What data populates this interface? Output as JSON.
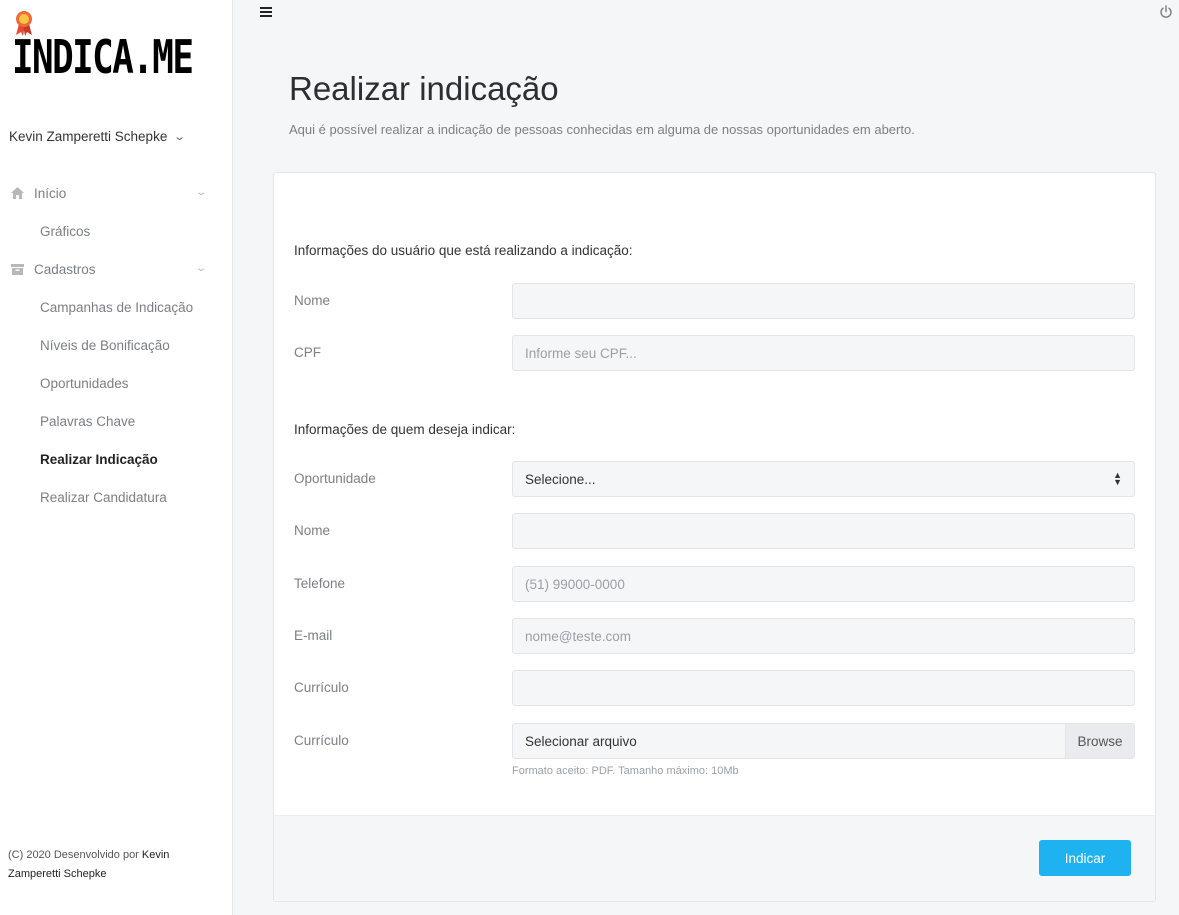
{
  "brand": {
    "logo_text": "INDICA.ME",
    "badge_color": "#f26a3b"
  },
  "user": {
    "name": "Kevin Zamperetti Schepke"
  },
  "sidebar": {
    "items": [
      {
        "label": "Início",
        "icon": "home-icon",
        "group": true
      },
      {
        "label": "Gráficos",
        "group": false
      },
      {
        "label": "Cadastros",
        "icon": "archive-icon",
        "group": true
      },
      {
        "label": "Campanhas de Indicação",
        "group": false
      },
      {
        "label": "Níveis de Bonificação",
        "group": false
      },
      {
        "label": "Oportunidades",
        "group": false
      },
      {
        "label": "Palavras Chave",
        "group": false
      },
      {
        "label": "Realizar Indicação",
        "group": false,
        "active": true
      },
      {
        "label": "Realizar Candidatura",
        "group": false
      }
    ]
  },
  "footer": {
    "prefix": "(C) 2020 Desenvolvido por ",
    "author": "Kevin Zamperetti Schepke"
  },
  "page": {
    "title": "Realizar indicação",
    "subtitle": "Aqui é possível realizar a indicação de pessoas conhecidas em alguma de nossas oportunidades em aberto."
  },
  "form": {
    "section1_title": "Informações do usuário que está realizando a indicação:",
    "nome_label": "Nome",
    "nome_value": "",
    "cpf_label": "CPF",
    "cpf_placeholder": "Informe seu CPF...",
    "section2_title": "Informações de quem deseja indicar:",
    "oportunidade_label": "Oportunidade",
    "oportunidade_selected": "Selecione...",
    "indicado_nome_label": "Nome",
    "telefone_label": "Telefone",
    "telefone_placeholder": "(51) 99000-0000",
    "email_label": "E-mail",
    "email_placeholder": "nome@teste.com",
    "curriculo_label": "Currículo",
    "curriculo_file_label": "Currículo",
    "file_placeholder": "Selecionar arquivo",
    "browse_label": "Browse",
    "file_help": "Formato aceito: PDF. Tamanho máximo: 10Mb",
    "submit_label": "Indicar"
  },
  "colors": {
    "accent": "#1eb3f0",
    "background": "#f5f6f8"
  }
}
